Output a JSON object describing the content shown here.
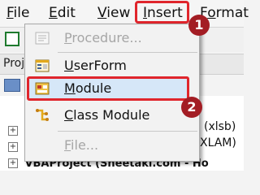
{
  "menubar": {
    "items": [
      {
        "label": "File",
        "underline": "F"
      },
      {
        "label": "Edit",
        "underline": "E"
      },
      {
        "label": "View",
        "underline": "V"
      },
      {
        "label": "Insert",
        "underline": "I"
      },
      {
        "label": "Format",
        "underline": "o"
      }
    ]
  },
  "project": {
    "title_partial": "Proj",
    "rows": [
      {
        "label": "(xlsb)"
      },
      {
        "label": "XLAM)"
      },
      {
        "label": "VBAProject (Sheetaki.com - Ho"
      }
    ]
  },
  "insert_menu": {
    "items": [
      {
        "label": "Procedure...",
        "enabled": false,
        "icon": "procedure-icon"
      },
      {
        "label": "UserForm",
        "enabled": true,
        "icon": "userform-icon"
      },
      {
        "label": "Module",
        "enabled": true,
        "icon": "module-icon",
        "highlighted": true
      },
      {
        "label": "Class Module",
        "enabled": true,
        "icon": "class-module-icon"
      },
      {
        "label": "File...",
        "enabled": false,
        "icon": "file-icon"
      }
    ]
  },
  "steps": {
    "one": "1",
    "two": "2"
  },
  "colors": {
    "highlight_border": "#e0252c",
    "badge": "#a31d24",
    "selection": "#d6e7f8"
  }
}
